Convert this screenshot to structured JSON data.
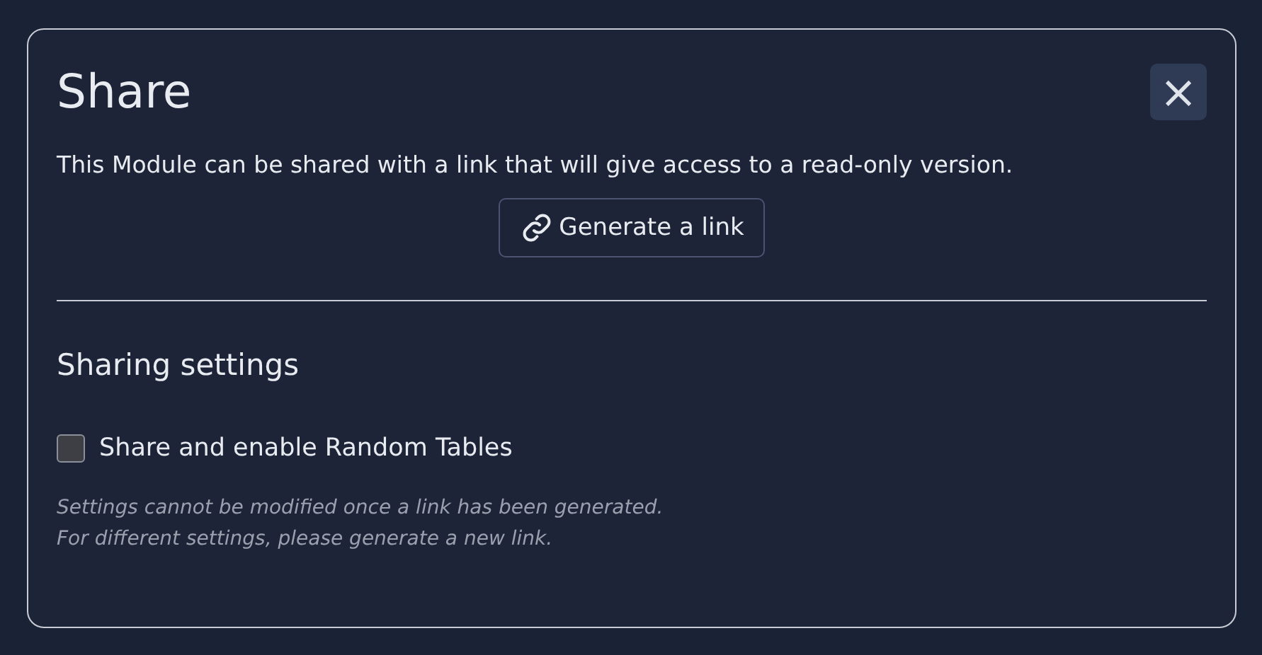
{
  "dialog": {
    "title": "Share",
    "close": "×",
    "description": "This Module can be shared with a link that will give access to a read-only version.",
    "generate_button": "Generate a link",
    "settings_heading": "Sharing settings",
    "options": [
      {
        "label": "Share and enable Random Tables",
        "checked": false
      }
    ],
    "notes": [
      "Settings cannot be modified once a link has been generated.",
      "For different settings, please generate a new link."
    ]
  }
}
